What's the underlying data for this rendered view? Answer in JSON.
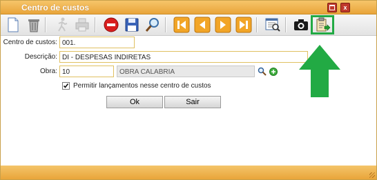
{
  "window": {
    "title": "Centro de custos",
    "colors": {
      "titlebar": "#e9a53a",
      "highlight": "#22aa44"
    }
  },
  "toolbar": {
    "items": [
      {
        "name": "new-icon"
      },
      {
        "name": "delete-icon"
      },
      {
        "name": "run-icon"
      },
      {
        "name": "print-icon"
      },
      {
        "name": "cancel-icon"
      },
      {
        "name": "save-icon"
      },
      {
        "name": "search-icon"
      },
      {
        "name": "first-record-icon"
      },
      {
        "name": "previous-record-icon"
      },
      {
        "name": "next-record-icon"
      },
      {
        "name": "last-record-icon"
      },
      {
        "name": "report-icon"
      },
      {
        "name": "camera-icon"
      },
      {
        "name": "clipboard-export-icon"
      }
    ]
  },
  "form": {
    "centro_label": "Centro de custos:",
    "centro_value": "001.",
    "descricao_label": "Descrição:",
    "descricao_value": "DI - DESPESAS INDIRETAS",
    "obra_label": "Obra:",
    "obra_code": "10",
    "obra_name": "OBRA CALABRIA",
    "permitir_label": "Permitir lançamentos nesse centro de custos",
    "permitir_checked": true
  },
  "actions": {
    "ok_label": "Ok",
    "sair_label": "Sair"
  }
}
